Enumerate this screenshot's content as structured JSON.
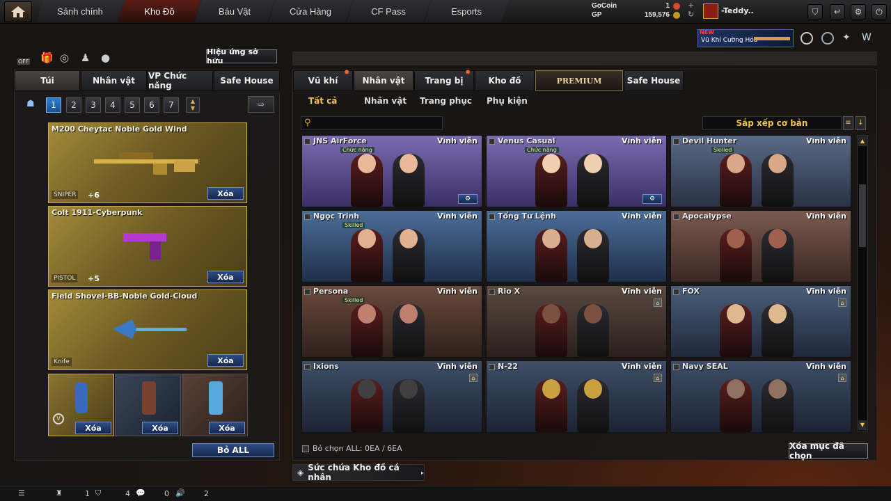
{
  "nav": {
    "tabs": [
      "Sảnh chính",
      "Kho Đồ",
      "Báu Vật",
      "Cửa Hàng",
      "CF Pass",
      "Esports"
    ],
    "active_index": 1
  },
  "currency": {
    "gocoin_label": "GoCoin",
    "gocoin_value": "1",
    "gp_label": "GP",
    "gp_value": "159,576"
  },
  "user": {
    "name": "-Teddy.."
  },
  "promo": {
    "new": "NEW",
    "text": "Vũ Khí Cường Hóa"
  },
  "left": {
    "effect_button": "Hiệu ứng sở hữu",
    "off_label": "OFF",
    "tabs": [
      "Túi",
      "Nhân vật",
      "VP Chức năng",
      "Safe House"
    ],
    "pages": [
      "1",
      "2",
      "3",
      "4",
      "5",
      "6",
      "7"
    ],
    "items": [
      {
        "name": "M200 Cheytac Noble Gold Wind",
        "class": "SNIPER",
        "plus": "+6",
        "delete": "Xóa"
      },
      {
        "name": "Colt 1911-Cyberpunk",
        "class": "PISTOL",
        "plus": "+5",
        "delete": "Xóa"
      },
      {
        "name": "Field Shovel-BB-Noble Gold-Cloud",
        "class": "Knife",
        "plus": "",
        "delete": "Xóa"
      }
    ],
    "slots_delete": "Xóa",
    "clear_all": "Bỏ ALL"
  },
  "right": {
    "tabs": [
      "Vũ khí",
      "Nhân vật",
      "Trang bị",
      "Kho đồ",
      "PREMIUM",
      "Safe House"
    ],
    "filters": [
      "Tất cả",
      "Nhân vật",
      "Trang phục",
      "Phụ kiện"
    ],
    "sort_label": "Sắp xếp cơ bản",
    "search_placeholder": "",
    "permanent": "Vĩnh viễn",
    "characters": [
      {
        "name": "JNS AirForce",
        "tag": "Chức năng"
      },
      {
        "name": "Venus Casual",
        "tag": "Chức năng"
      },
      {
        "name": "Devil Hunter",
        "tag": "Skilled"
      },
      {
        "name": "Ngọc Trinh",
        "tag": "Skilled"
      },
      {
        "name": "Tổng Tư Lệnh",
        "tag": ""
      },
      {
        "name": "Apocalypse",
        "tag": ""
      },
      {
        "name": "Persona",
        "tag": "Skilled"
      },
      {
        "name": "Rio X",
        "tag": ""
      },
      {
        "name": "FOX",
        "tag": ""
      },
      {
        "name": "Ixions",
        "tag": ""
      },
      {
        "name": "N-22",
        "tag": ""
      },
      {
        "name": "Navy SEAL",
        "tag": ""
      }
    ],
    "select_all": "Bỏ chọn ALL: 0EA / 6EA",
    "delete_selected": "Xóa mục đã chọn",
    "capacity": "Sức chứa Kho đồ cá nhân"
  },
  "status": {
    "a": "1",
    "b": "4",
    "c": "0",
    "d": "2"
  },
  "colors": {
    "accent": "#f2c24b",
    "button_blue": "#2e4c86",
    "active_tab": "#5b1d14"
  }
}
